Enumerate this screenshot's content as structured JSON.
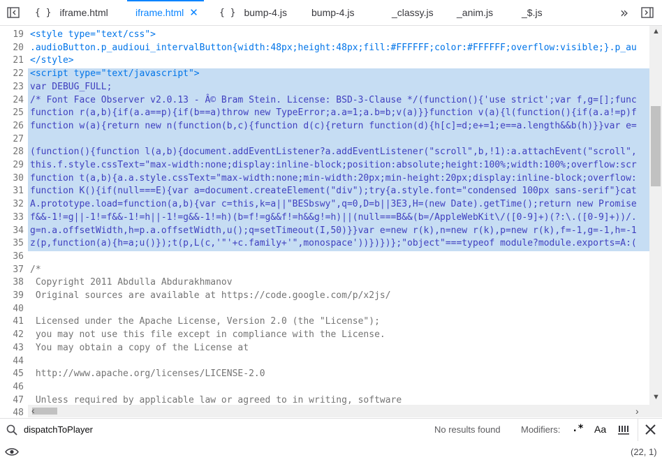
{
  "tabs": [
    {
      "label": "iframe.html",
      "braces": "{ }",
      "active": false
    },
    {
      "label": "iframe.html",
      "braces": "",
      "active": true
    },
    {
      "label": "bump-4.js",
      "braces": "{ }",
      "active": false
    },
    {
      "label": "bump-4.js",
      "braces": "",
      "active": false
    },
    {
      "label": "_classy.js",
      "braces": "",
      "active": false
    },
    {
      "label": "_anim.js",
      "braces": "",
      "active": false
    },
    {
      "label": "_$.js",
      "braces": "",
      "active": false
    }
  ],
  "lines": [
    {
      "n": "19",
      "text": "<style type=\"text/css\">"
    },
    {
      "n": "20",
      "text": ".audioButton.p_audioui_intervalButton{width:48px;height:48px;fill:#FFFFFF;color:#FFFFFF;overflow:visible;}.p_au"
    },
    {
      "n": "21",
      "text": "</style>"
    },
    {
      "n": "22",
      "text": "<script type=\"text/javascript\">"
    },
    {
      "n": "23",
      "text": "var DEBUG_FULL;"
    },
    {
      "n": "24",
      "text": "/* Font Face Observer v2.0.13 - Â© Bram Stein. License: BSD-3-Clause */(function(){'use strict';var f,g=[];func"
    },
    {
      "n": "25",
      "text": "function r(a,b){if(a.a==p){if(b==a)throw new TypeError;a.a=1;a.b=b;v(a)}}function v(a){l(function(){if(a.a!=p)f"
    },
    {
      "n": "26",
      "text": "function w(a){return new n(function(b,c){function d(c){return function(d){h[c]=d;e+=1;e==a.length&&b(h)}}var e="
    },
    {
      "n": "27",
      "text": ""
    },
    {
      "n": "28",
      "text": "(function(){function l(a,b){document.addEventListener?a.addEventListener(\"scroll\",b,!1):a.attachEvent(\"scroll\","
    },
    {
      "n": "29",
      "text": "this.f.style.cssText=\"max-width:none;display:inline-block;position:absolute;height:100%;width:100%;overflow:scr"
    },
    {
      "n": "30",
      "text": "function t(a,b){a.a.style.cssText=\"max-width:none;min-width:20px;min-height:20px;display:inline-block;overflow:"
    },
    {
      "n": "31",
      "text": "function K(){if(null===E){var a=document.createElement(\"div\");try{a.style.font=\"condensed 100px sans-serif\"}cat"
    },
    {
      "n": "32",
      "text": "A.prototype.load=function(a,b){var c=this,k=a||\"BESbswy\",q=0,D=b||3E3,H=(new Date).getTime();return new Promise"
    },
    {
      "n": "33",
      "text": "f&&-1!=g||-1!=f&&-1!=h||-1!=g&&-1!=h)(b=f!=g&&f!=h&&g!=h)||(null===B&&(b=/AppleWebKit\\/([0-9]+)(?:\\.([0-9]+))/."
    },
    {
      "n": "34",
      "text": "g=n.a.offsetWidth,h=p.a.offsetWidth,u();q=setTimeout(I,50)}}var e=new r(k),n=new r(k),p=new r(k),f=-1,g=-1,h=-1"
    },
    {
      "n": "35",
      "text": "z(p,function(a){h=a;u()});t(p,L(c,'\"'+c.family+'\",monospace'))})})};\"object\"===typeof module?module.exports=A:("
    },
    {
      "n": "36",
      "text": ""
    },
    {
      "n": "37",
      "text": "/*"
    },
    {
      "n": "38",
      "text": " Copyright 2011 Abdulla Abdurakhmanov"
    },
    {
      "n": "39",
      "text": " Original sources are available at https://code.google.com/p/x2js/"
    },
    {
      "n": "40",
      "text": ""
    },
    {
      "n": "41",
      "text": " Licensed under the Apache License, Version 2.0 (the \"License\");"
    },
    {
      "n": "42",
      "text": " you may not use this file except in compliance with the License."
    },
    {
      "n": "43",
      "text": " You may obtain a copy of the License at"
    },
    {
      "n": "44",
      "text": ""
    },
    {
      "n": "45",
      "text": " http://www.apache.org/licenses/LICENSE-2.0"
    },
    {
      "n": "46",
      "text": ""
    },
    {
      "n": "47",
      "text": " Unless required by applicable law or agreed to in writing, software"
    },
    {
      "n": "48",
      "text": ""
    }
  ],
  "search": {
    "query": "dispatchToPlayer",
    "result": "No results found",
    "modifiers_label": "Modifiers:",
    "regex_label": ".*",
    "case_label": "Aa"
  },
  "status": {
    "cursor": "(22, 1)"
  },
  "colors": {
    "accent": "#0a84ff",
    "selection": "#c6ddf3"
  }
}
